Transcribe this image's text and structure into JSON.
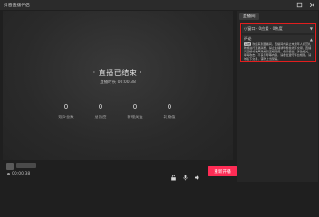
{
  "window": {
    "title": "抖音直播伴侣",
    "controls": [
      "minimize-icon",
      "maximize-icon",
      "close-icon"
    ]
  },
  "stage": {
    "ended_text": "· 直播已结束 ·",
    "duration_label": "直播时长 00:00:38",
    "stats": [
      {
        "value": "0",
        "label": "观众总数"
      },
      {
        "value": "0",
        "label": "总热度"
      },
      {
        "value": "0",
        "label": "新增关注"
      },
      {
        "value": "0",
        "label": "礼物值"
      }
    ]
  },
  "bottom": {
    "status_time": "00:00:38",
    "icons": [
      "lock-icon",
      "microphone-icon",
      "speaker-icon"
    ],
    "restart_button": "重新开播"
  },
  "panel": {
    "tab_label": "直播间",
    "select_value": "小窗口 · 0应援 · 0热度",
    "comments_title": "评论",
    "system_badge": "系统",
    "system_message": "欢迎来到直播间，直播间内禁止未成年人打赏礼物或进行直播消费，禁止主播诱导粉丝线下交易，直播间违规将被严肃处罚违规视频、色情低俗、涉政相关、辱骂攻击、不良引导等内容，请各位遵守平台规则。请勿私下交易，谨防上当受骗。"
  },
  "colors": {
    "accent": "#fe2c55",
    "highlight_border": "#e21e1e"
  }
}
